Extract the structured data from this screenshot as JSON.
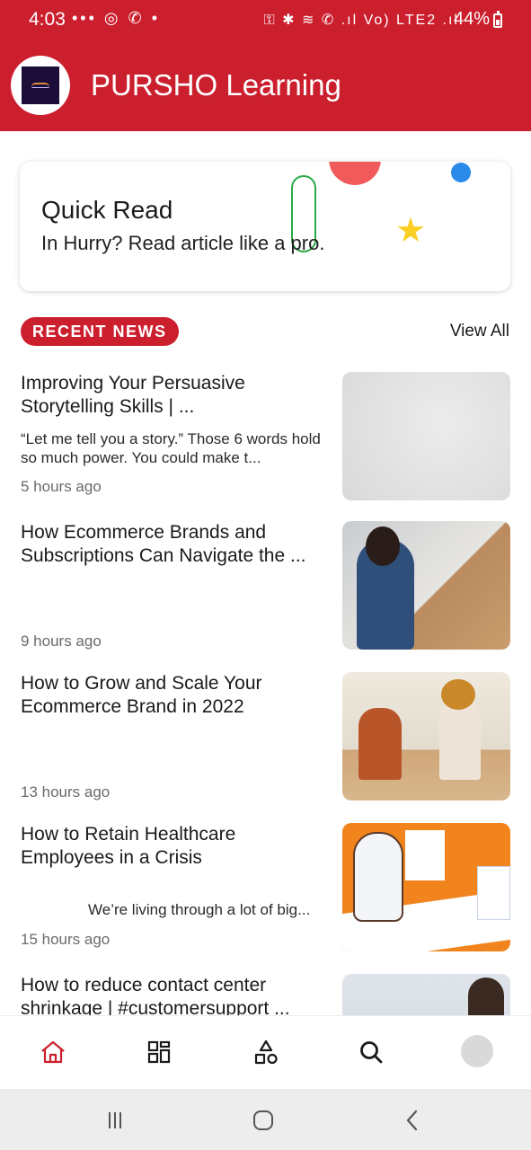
{
  "status_bar": {
    "time": "4:03",
    "left_icons": "••• ◎ ✆ •",
    "right_icons": "⚿ ✱ ≋ ✆ .ıl Vo) LTE2 .ıl",
    "battery": "44%"
  },
  "app": {
    "title": "PURSHO Learning",
    "brand_color": "#cc1f2e"
  },
  "quick_read": {
    "title": "Quick Read",
    "subtitle": "In Hurry? Read article like a pro."
  },
  "recent_news": {
    "badge": "RECENT NEWS",
    "view_all": "View All",
    "items": [
      {
        "title": "Improving Your Persuasive Storytelling Skills | ...",
        "desc": "“Let me tell you a story.” Those 6 words hold so much power. You could make t...",
        "time": "5 hours ago"
      },
      {
        "title": "How Ecommerce Brands and Subscriptions Can Navigate the ...",
        "desc": "",
        "time": "9 hours ago"
      },
      {
        "title": "How to Grow and Scale Your Ecommerce Brand in 2022",
        "desc": "",
        "time": "13 hours ago"
      },
      {
        "title": "How to Retain Healthcare Employees in a Crisis",
        "desc": "We’re living through a lot of big...",
        "time": "15 hours ago"
      },
      {
        "title": "How to reduce contact center shrinkage | #customersupport ...",
        "desc": "",
        "time": ""
      }
    ]
  },
  "bottom_nav": {
    "items": [
      "home-icon",
      "grid-icon",
      "shapes-icon",
      "search-icon",
      "profile-avatar"
    ]
  },
  "system_nav": {
    "items": [
      "recents-icon",
      "home-circle-icon",
      "back-icon"
    ]
  }
}
